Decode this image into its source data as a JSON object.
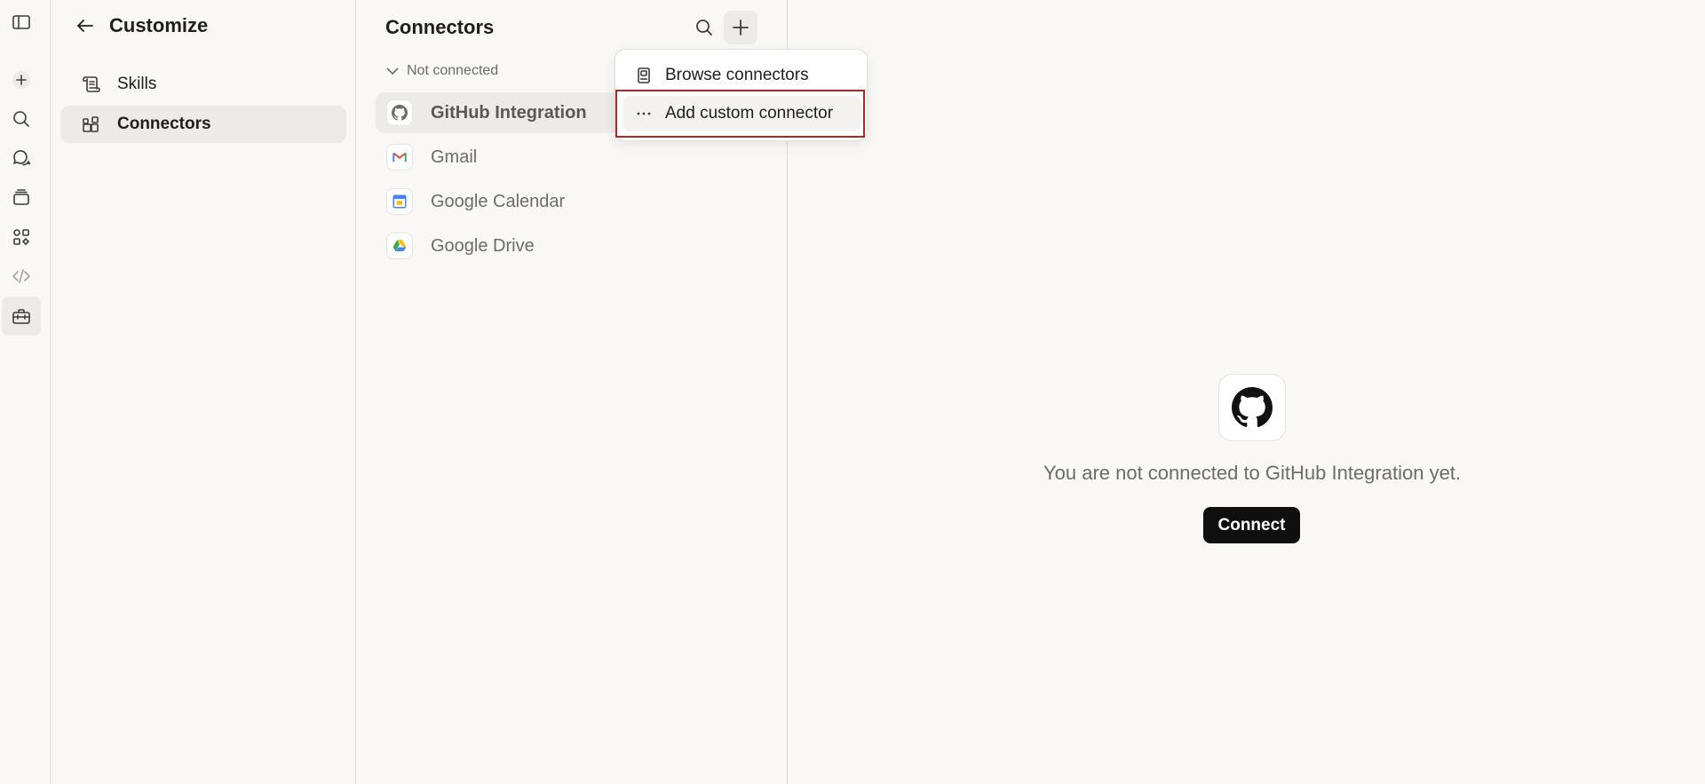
{
  "rail": {
    "items": [
      "sidebar-toggle",
      "new",
      "search",
      "chats",
      "projects",
      "artifacts",
      "code",
      "customize"
    ]
  },
  "customize": {
    "title": "Customize",
    "nav": [
      {
        "label": "Skills"
      },
      {
        "label": "Connectors"
      }
    ]
  },
  "connectors": {
    "title": "Connectors",
    "section_label": "Not connected",
    "items": [
      {
        "label": "GitHub Integration"
      },
      {
        "label": "Gmail"
      },
      {
        "label": "Google Calendar"
      },
      {
        "label": "Google Drive"
      }
    ]
  },
  "dropdown": {
    "items": [
      {
        "label": "Browse connectors"
      },
      {
        "label": "Add custom connector"
      }
    ]
  },
  "detail": {
    "message": "You are not connected to GitHub Integration yet.",
    "connect_label": "Connect"
  },
  "colors": {
    "background": "#f9f8f6",
    "active_bg": "#ecebe7",
    "highlight": "#b3261e",
    "button_bg": "#0f0f0f"
  }
}
